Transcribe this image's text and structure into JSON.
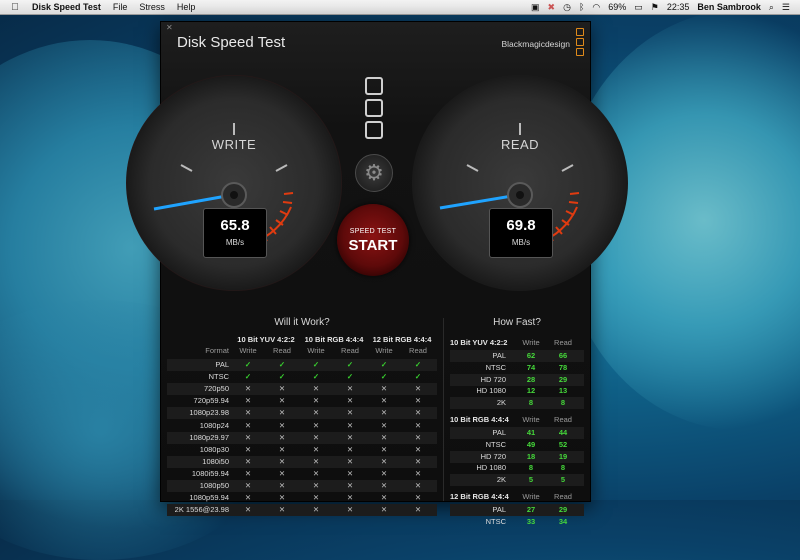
{
  "menubar": {
    "app_name": "Disk Speed Test",
    "items": [
      "File",
      "Stress",
      "Help"
    ],
    "battery": "69%",
    "time": "22:35",
    "user": "Ben Sambrook"
  },
  "window": {
    "title": "Disk Speed Test",
    "brand": "Blackmagicdesign",
    "accent_color": "#e08a1a"
  },
  "gauges": {
    "write": {
      "label": "WRITE",
      "value": "65.8",
      "unit": "MB/s"
    },
    "read": {
      "label": "READ",
      "value": "69.8",
      "unit": "MB/s"
    }
  },
  "start_button": {
    "small": "SPEED TEST",
    "big": "START"
  },
  "will_it_work": {
    "title": "Will it Work?",
    "format_header": "Format",
    "groups": [
      "10 Bit YUV 4:2:2",
      "10 Bit RGB 4:4:4",
      "12 Bit RGB 4:4:4"
    ],
    "subcols": [
      "Write",
      "Read"
    ],
    "rows": [
      {
        "format": "PAL",
        "marks": [
          "ok",
          "ok",
          "ok",
          "ok",
          "ok",
          "ok"
        ]
      },
      {
        "format": "NTSC",
        "marks": [
          "ok",
          "ok",
          "ok",
          "ok",
          "ok",
          "ok"
        ]
      },
      {
        "format": "720p50",
        "marks": [
          "no",
          "no",
          "no",
          "no",
          "no",
          "no"
        ]
      },
      {
        "format": "720p59.94",
        "marks": [
          "no",
          "no",
          "no",
          "no",
          "no",
          "no"
        ]
      },
      {
        "format": "1080p23.98",
        "marks": [
          "no",
          "no",
          "no",
          "no",
          "no",
          "no"
        ]
      },
      {
        "format": "1080p24",
        "marks": [
          "no",
          "no",
          "no",
          "no",
          "no",
          "no"
        ]
      },
      {
        "format": "1080p29.97",
        "marks": [
          "no",
          "no",
          "no",
          "no",
          "no",
          "no"
        ]
      },
      {
        "format": "1080p30",
        "marks": [
          "no",
          "no",
          "no",
          "no",
          "no",
          "no"
        ]
      },
      {
        "format": "1080i50",
        "marks": [
          "no",
          "no",
          "no",
          "no",
          "no",
          "no"
        ]
      },
      {
        "format": "1080i59.94",
        "marks": [
          "no",
          "no",
          "no",
          "no",
          "no",
          "no"
        ]
      },
      {
        "format": "1080p50",
        "marks": [
          "no",
          "no",
          "no",
          "no",
          "no",
          "no"
        ]
      },
      {
        "format": "1080p59.94",
        "marks": [
          "no",
          "no",
          "no",
          "no",
          "no",
          "no"
        ]
      },
      {
        "format": "2K 1556@23.98",
        "marks": [
          "no",
          "no",
          "no",
          "no",
          "no",
          "no"
        ]
      }
    ],
    "symbols": {
      "ok": "✓",
      "no": "✕"
    }
  },
  "how_fast": {
    "title": "How Fast?",
    "subcols": [
      "Write",
      "Read"
    ],
    "groups": [
      {
        "name": "10 Bit YUV 4:2:2",
        "rows": [
          {
            "label": "PAL",
            "write": "62",
            "read": "66"
          },
          {
            "label": "NTSC",
            "write": "74",
            "read": "78"
          },
          {
            "label": "HD 720",
            "write": "28",
            "read": "29"
          },
          {
            "label": "HD 1080",
            "write": "12",
            "read": "13"
          },
          {
            "label": "2K",
            "write": "8",
            "read": "8"
          }
        ]
      },
      {
        "name": "10 Bit RGB 4:4:4",
        "rows": [
          {
            "label": "PAL",
            "write": "41",
            "read": "44"
          },
          {
            "label": "NTSC",
            "write": "49",
            "read": "52"
          },
          {
            "label": "HD 720",
            "write": "18",
            "read": "19"
          },
          {
            "label": "HD 1080",
            "write": "8",
            "read": "8"
          },
          {
            "label": "2K",
            "write": "5",
            "read": "5"
          }
        ]
      },
      {
        "name": "12 Bit RGB 4:4:4",
        "rows": [
          {
            "label": "PAL",
            "write": "27",
            "read": "29"
          },
          {
            "label": "NTSC",
            "write": "33",
            "read": "34"
          }
        ]
      }
    ]
  }
}
